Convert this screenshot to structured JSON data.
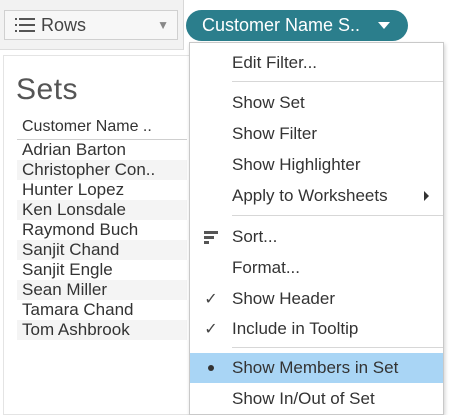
{
  "shelf": {
    "rows_label": "Rows",
    "pill_label": "Customer Name S.."
  },
  "sheet": {
    "title": "Sets",
    "column_header": "Customer Name ..",
    "members": [
      "Adrian Barton",
      "Christopher Con..",
      "Hunter Lopez",
      "Ken Lonsdale",
      "Raymond Buch",
      "Sanjit Chand",
      "Sanjit Engle",
      "Sean Miller",
      "Tamara Chand",
      "Tom Ashbrook"
    ]
  },
  "menu": {
    "items": [
      {
        "label": "Edit Filter...",
        "icon": "none"
      },
      {
        "label": "Show Set",
        "icon": "none"
      },
      {
        "label": "Show Filter",
        "icon": "none"
      },
      {
        "label": "Show Highlighter",
        "icon": "none"
      },
      {
        "label": "Apply to Worksheets",
        "icon": "submenu-arrow"
      },
      {
        "label": "Sort...",
        "icon": "sort-icon"
      },
      {
        "label": "Format...",
        "icon": "none"
      },
      {
        "label": "Show Header",
        "icon": "checkmark"
      },
      {
        "label": "Include in Tooltip",
        "icon": "checkmark"
      },
      {
        "label": "Show Members in Set",
        "icon": "bullet",
        "highlighted": true
      },
      {
        "label": "Show In/Out of Set",
        "icon": "none"
      }
    ]
  },
  "colors": {
    "pill": "#2b7e8c",
    "highlight": "#a9d5f5"
  }
}
